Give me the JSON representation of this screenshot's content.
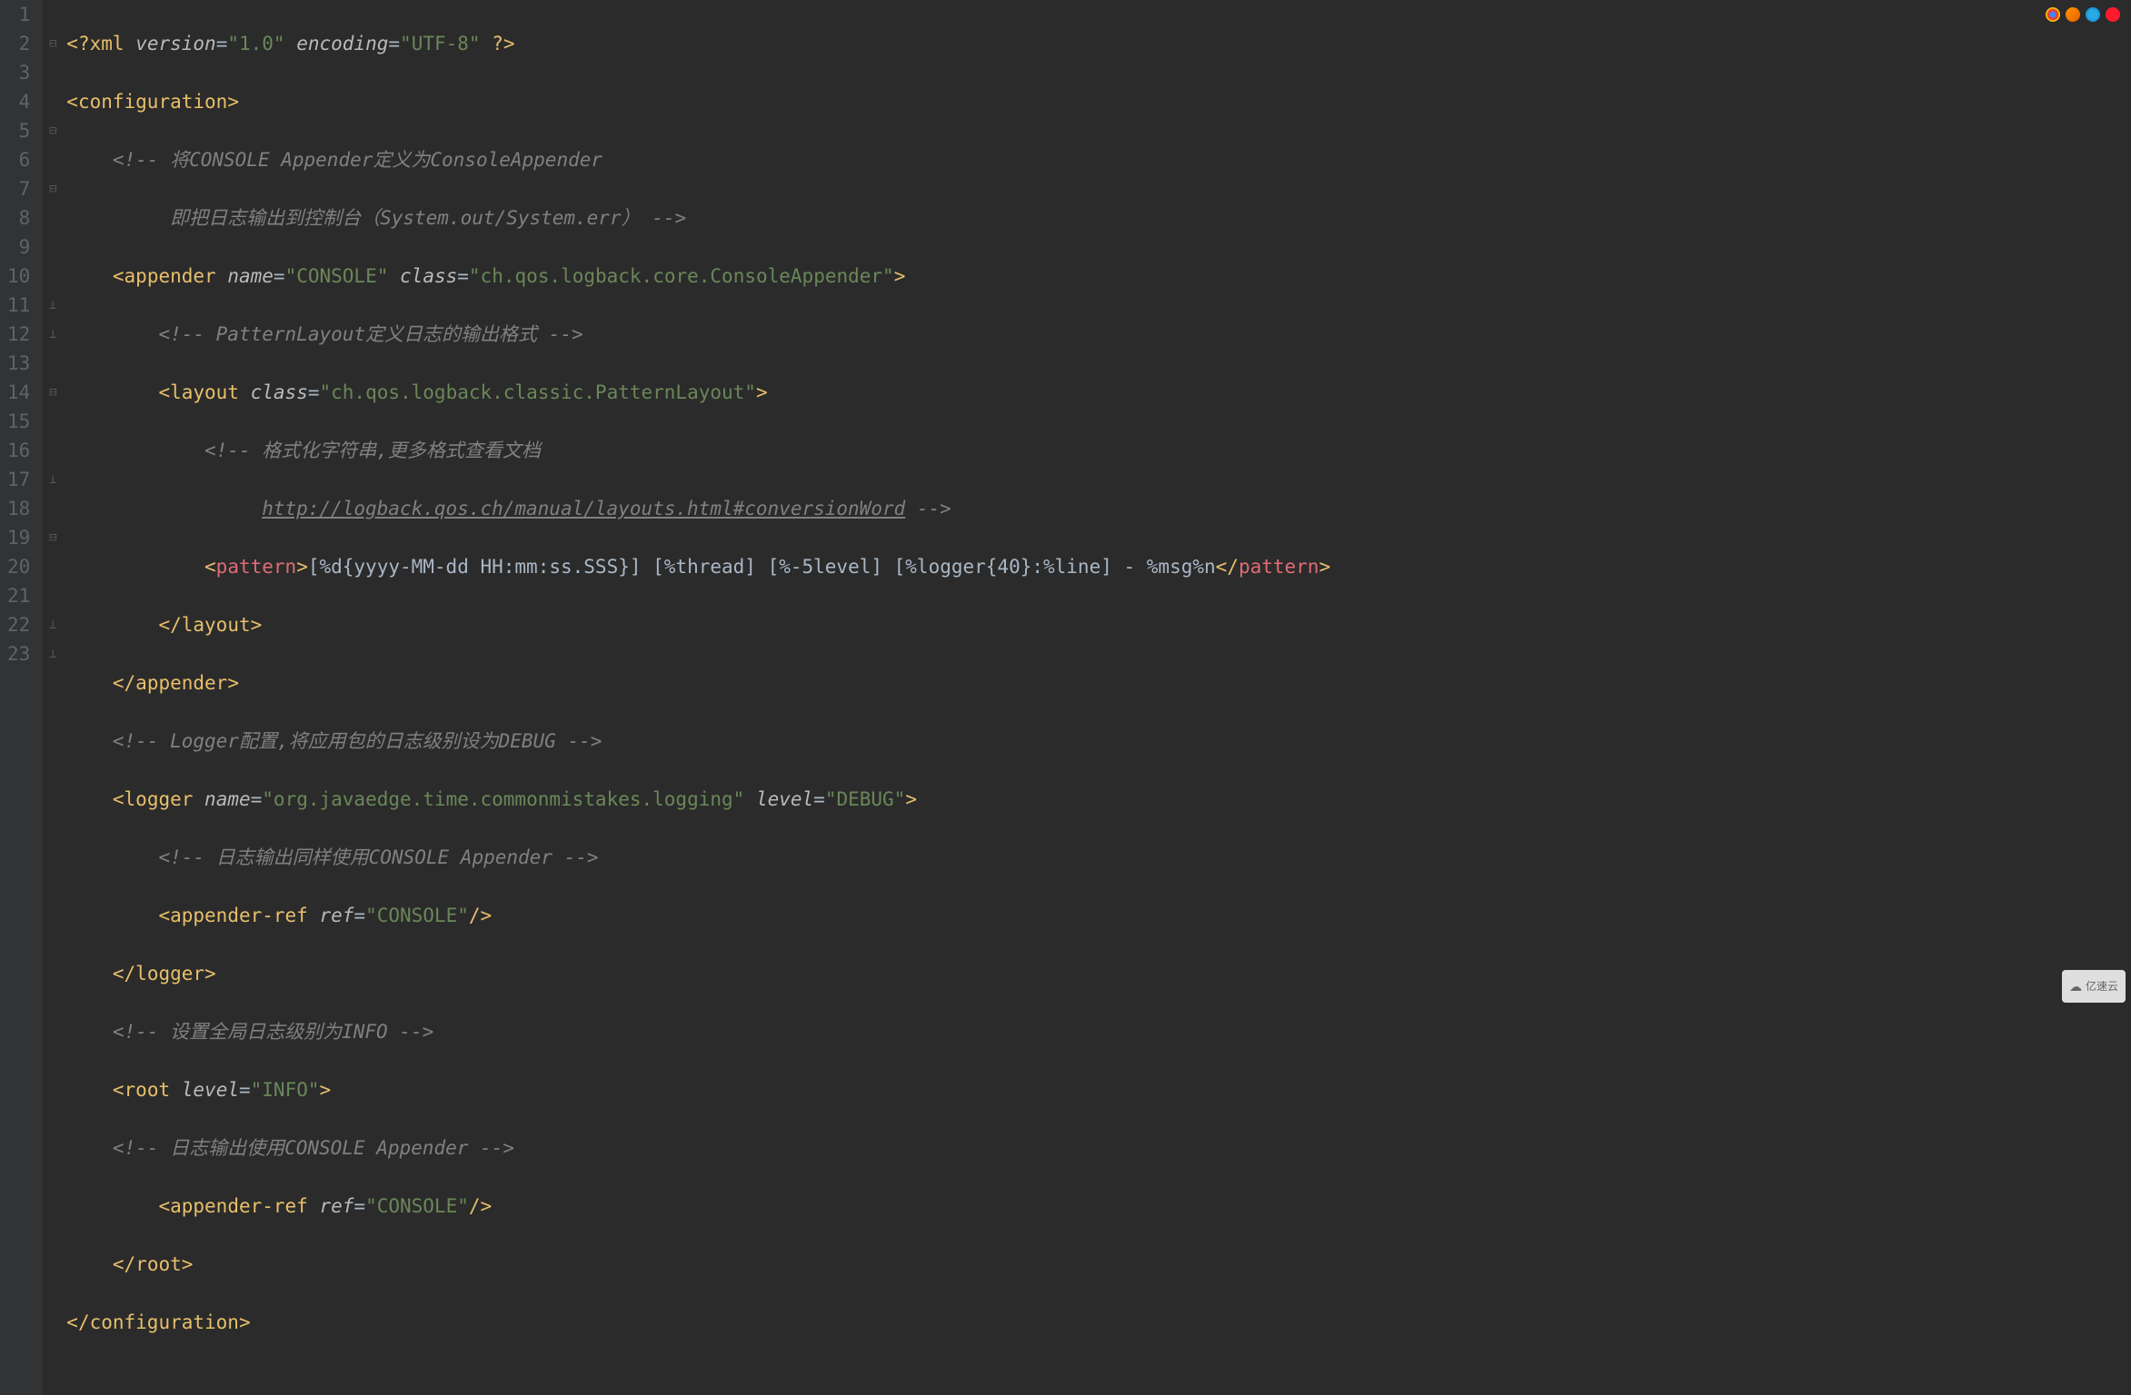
{
  "line_numbers": [
    "1",
    "2",
    "3",
    "4",
    "5",
    "6",
    "7",
    "8",
    "9",
    "10",
    "11",
    "12",
    "13",
    "14",
    "15",
    "16",
    "17",
    "18",
    "19",
    "20",
    "21",
    "22",
    "23"
  ],
  "code": {
    "l1": {
      "xml": "xml",
      "version_attr": "version",
      "version_val": "\"1.0\"",
      "encoding_attr": "encoding",
      "encoding_val": "\"UTF-8\""
    },
    "l2": {
      "tag": "configuration"
    },
    "l3": {
      "cmt": "<!-- 将CONSOLE Appender定义为ConsoleAppender"
    },
    "l4": {
      "cmt": "即把日志输出到控制台（System.out/System.err） -->"
    },
    "l5": {
      "tag": "appender",
      "name_attr": "name",
      "name_val": "\"CONSOLE\"",
      "class_attr": "class",
      "class_val": "\"ch.qos.logback.core.ConsoleAppender\""
    },
    "l6": {
      "cmt": "<!-- PatternLayout定义日志的输出格式 -->"
    },
    "l7": {
      "tag": "layout",
      "class_attr": "class",
      "class_val": "\"ch.qos.logback.classic.PatternLayout\""
    },
    "l8": {
      "cmt": "<!-- 格式化字符串,更多格式查看文档"
    },
    "l9": {
      "link": "http://logback.qos.ch/manual/layouts.html#conversionWord",
      "tail": " -->"
    },
    "l10": {
      "tag": "pattern",
      "text": "[%d{yyyy-MM-dd HH:mm:ss.SSS}] [%thread] [%-5level] [%logger{40}:%line] - %msg%n"
    },
    "l11": {
      "close": "layout"
    },
    "l12": {
      "close": "appender"
    },
    "l13": {
      "cmt": "<!-- Logger配置,将应用包的日志级别设为DEBUG -->"
    },
    "l14": {
      "tag": "logger",
      "name_attr": "name",
      "name_val": "\"org.javaedge.time.commonmistakes.logging\"",
      "level_attr": "level",
      "level_val": "\"DEBUG\""
    },
    "l15": {
      "cmt": "<!-- 日志输出同样使用CONSOLE Appender -->"
    },
    "l16": {
      "tag": "appender-ref",
      "ref_attr": "ref",
      "ref_val": "\"CONSOLE\""
    },
    "l17": {
      "close": "logger"
    },
    "l18": {
      "cmt": "<!-- 设置全局日志级别为INFO -->"
    },
    "l19": {
      "tag": "root",
      "level_attr": "level",
      "level_val": "\"INFO\""
    },
    "l20": {
      "cmt": "<!-- 日志输出使用CONSOLE Appender -->"
    },
    "l21": {
      "tag": "appender-ref",
      "ref_attr": "ref",
      "ref_val": "\"CONSOLE\""
    },
    "l22": {
      "close": "root"
    },
    "l23": {
      "close": "configuration"
    }
  },
  "watermark": "亿速云"
}
